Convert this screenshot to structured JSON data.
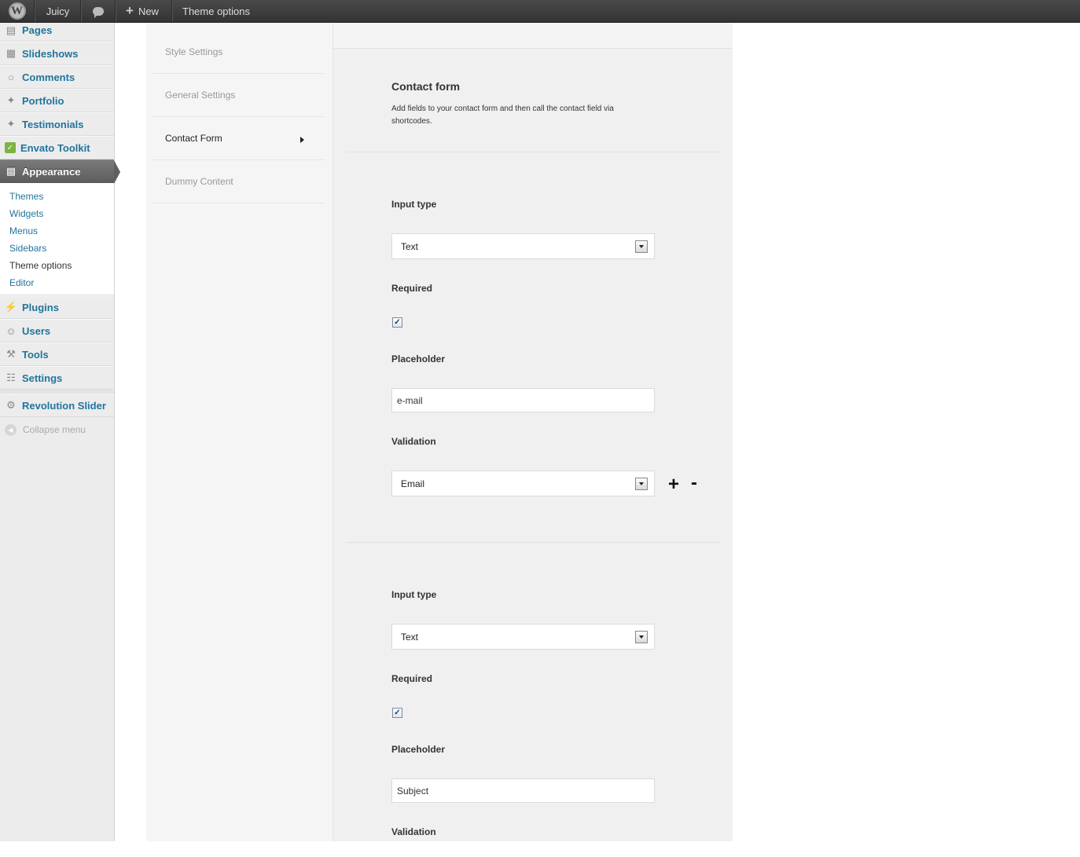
{
  "admin_bar": {
    "logo": "wordpress-icon",
    "site_name": "Juicy",
    "comments_icon": "comment-bubble-icon",
    "new_label": "New",
    "current_page": "Theme options"
  },
  "admin_menu": {
    "items_top": [
      {
        "label": "Pages",
        "icon": "pages-icon"
      },
      {
        "label": "Slideshows",
        "icon": "slideshows-icon"
      },
      {
        "label": "Comments",
        "icon": "comments-icon"
      },
      {
        "label": "Portfolio",
        "icon": "pin-icon"
      },
      {
        "label": "Testimonials",
        "icon": "pin-icon"
      },
      {
        "label": "Envato Toolkit",
        "icon": "envato-icon"
      },
      {
        "label": "Appearance",
        "icon": "appearance-icon"
      }
    ],
    "appearance_submenu": [
      "Themes",
      "Widgets",
      "Menus",
      "Sidebars",
      "Theme options",
      "Editor"
    ],
    "items_bottom": [
      {
        "label": "Plugins",
        "icon": "plugins-icon"
      },
      {
        "label": "Users",
        "icon": "users-icon"
      },
      {
        "label": "Tools",
        "icon": "tools-icon"
      },
      {
        "label": "Settings",
        "icon": "settings-icon"
      }
    ],
    "revolution_slider": "Revolution Slider",
    "collapse": "Collapse menu"
  },
  "theme_tabs": [
    "Style Settings",
    "General Settings",
    "Contact Form",
    "Dummy Content"
  ],
  "section": {
    "title": "Contact form",
    "description": "Add fields to your contact form and then call the contact field via shortcodes."
  },
  "fields": [
    {
      "input_type_label": "Input type",
      "input_type_value": "Text",
      "required_label": "Required",
      "required_checked": true,
      "placeholder_label": "Placeholder",
      "placeholder_value": "e-mail",
      "validation_label": "Validation",
      "validation_value": "Email",
      "add": "+",
      "remove": "-"
    },
    {
      "input_type_label": "Input type",
      "input_type_value": "Text",
      "required_label": "Required",
      "required_checked": true,
      "placeholder_label": "Placeholder",
      "placeholder_value": "Subject",
      "validation_label": "Validation"
    }
  ],
  "colors": {
    "link": "#21759b",
    "admin_bar": "#464646",
    "menu_bg": "#ececec",
    "current_menu": "#6d6d6d"
  }
}
